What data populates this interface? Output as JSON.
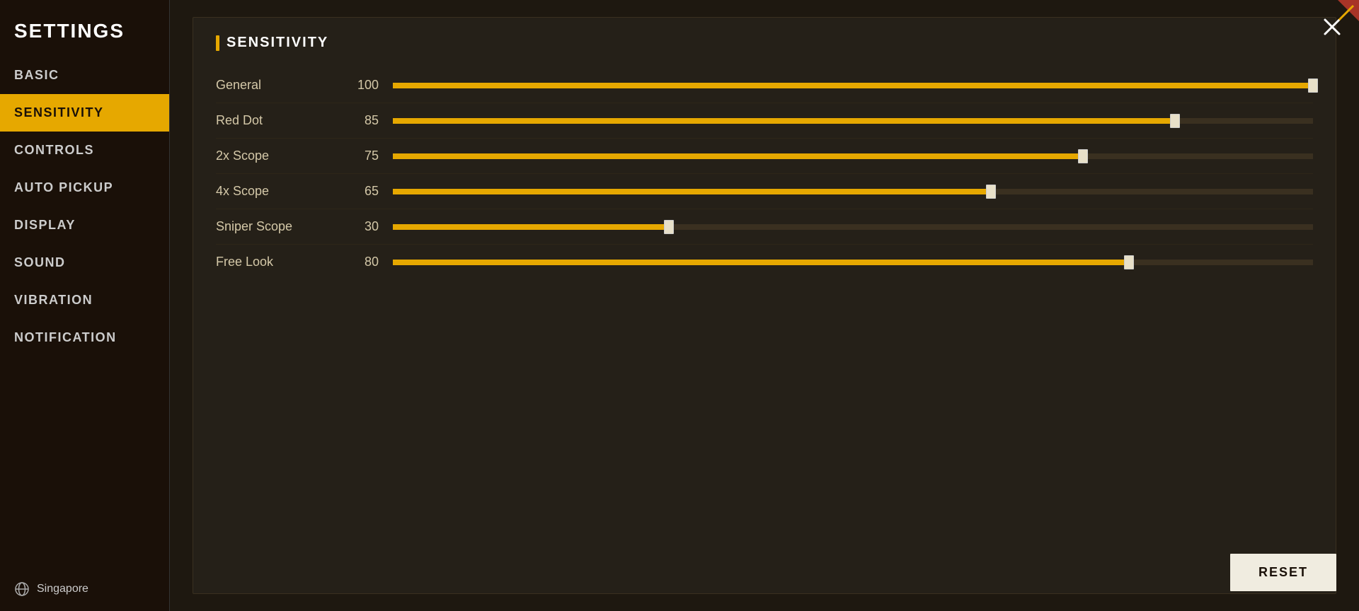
{
  "sidebar": {
    "title": "SETTINGS",
    "nav_items": [
      {
        "id": "basic",
        "label": "BASIC",
        "active": false
      },
      {
        "id": "sensitivity",
        "label": "SENSITIVITY",
        "active": true
      },
      {
        "id": "controls",
        "label": "CONTROLS",
        "active": false
      },
      {
        "id": "auto_pickup",
        "label": "AUTO PICKUP",
        "active": false
      },
      {
        "id": "display",
        "label": "DISPLAY",
        "active": false
      },
      {
        "id": "sound",
        "label": "SOUND",
        "active": false
      },
      {
        "id": "vibration",
        "label": "VIBRATION",
        "active": false
      },
      {
        "id": "notification",
        "label": "NOTIFICATION",
        "active": false
      }
    ],
    "region": "Singapore"
  },
  "close_button_label": "×",
  "section": {
    "title": "SENSITIVITY",
    "sliders": [
      {
        "id": "general",
        "label": "General",
        "value": 100,
        "percent": 100
      },
      {
        "id": "red_dot",
        "label": "Red Dot",
        "value": 85,
        "percent": 85
      },
      {
        "id": "scope_2x",
        "label": "2x Scope",
        "value": 75,
        "percent": 75
      },
      {
        "id": "scope_4x",
        "label": "4x Scope",
        "value": 65,
        "percent": 65
      },
      {
        "id": "sniper_scope",
        "label": "Sniper Scope",
        "value": 30,
        "percent": 30
      },
      {
        "id": "free_look",
        "label": "Free Look",
        "value": 80,
        "percent": 80
      }
    ]
  },
  "reset_button": "RESET",
  "colors": {
    "accent": "#e6a800",
    "active_nav_bg": "#e6a800",
    "active_nav_text": "#1a1008"
  }
}
